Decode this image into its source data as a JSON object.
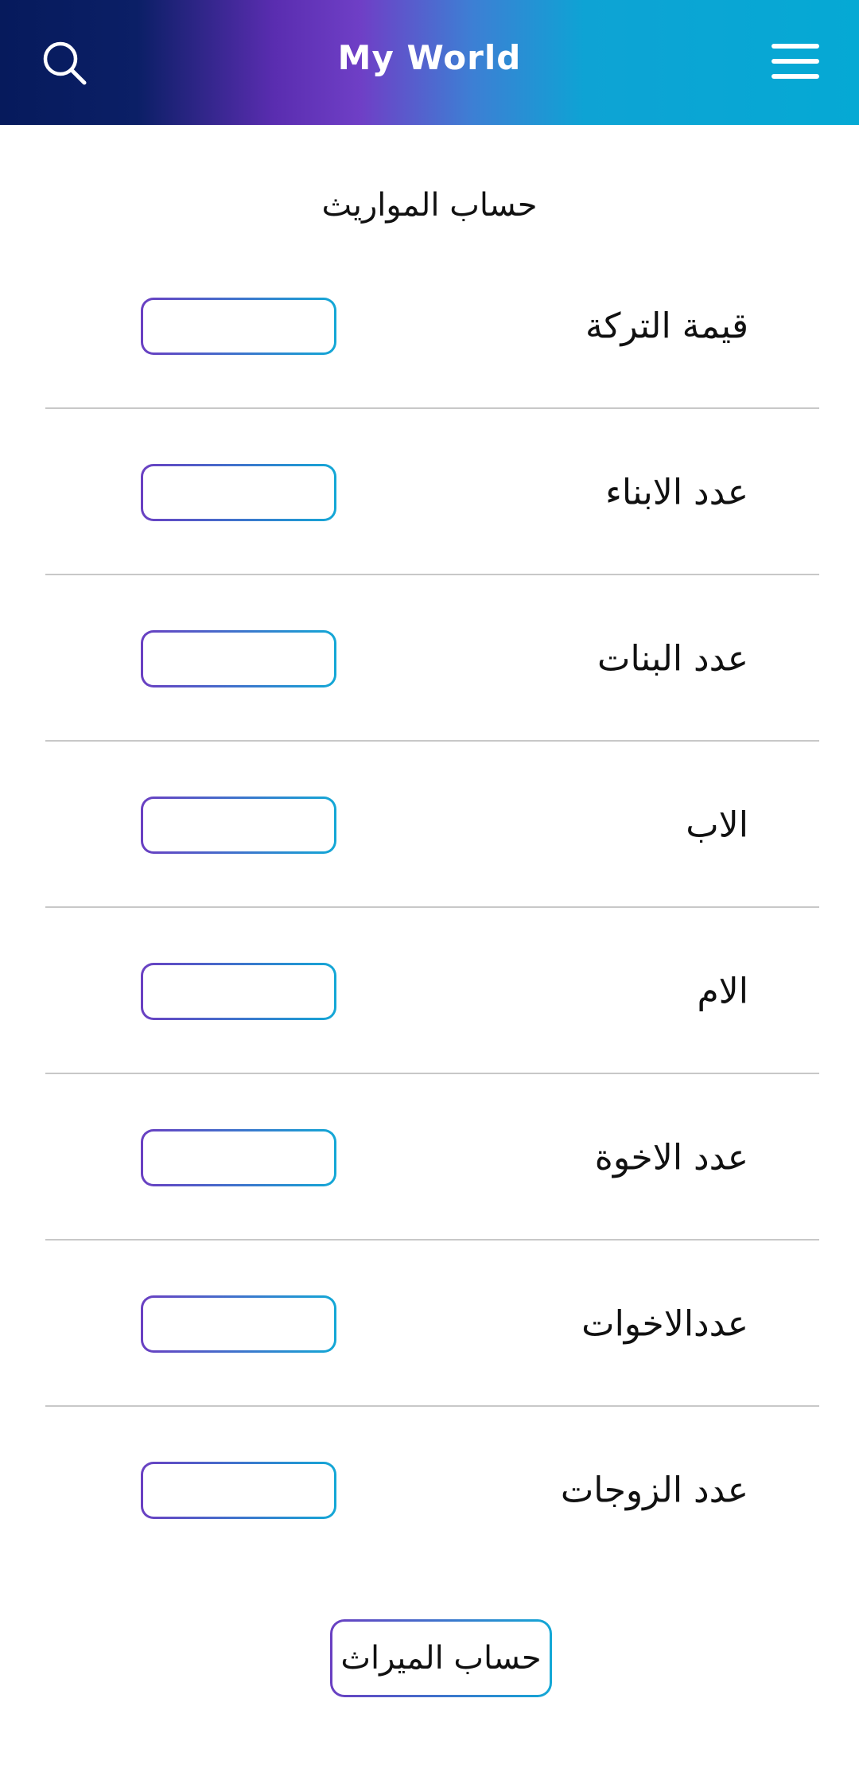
{
  "header": {
    "title": "My World",
    "search_icon": "search-icon",
    "menu_icon": "hamburger-menu-icon",
    "gradient_colors": [
      "#061a5c",
      "#6f3fc6",
      "#05a9d4"
    ]
  },
  "page": {
    "title": "حساب المواريث"
  },
  "form": {
    "fields": [
      {
        "label": "قيمة التركة",
        "value": ""
      },
      {
        "label": "عدد الابناء",
        "value": ""
      },
      {
        "label": "عدد البنات",
        "value": ""
      },
      {
        "label": "الاب",
        "value": ""
      },
      {
        "label": "الام",
        "value": ""
      },
      {
        "label": "عدد الاخوة",
        "value": ""
      },
      {
        "label": "عددالاخوات",
        "value": ""
      },
      {
        "label": "عدد الزوجات",
        "value": ""
      }
    ],
    "field_border_colors": [
      "#6a3fc2",
      "#13a8d6"
    ]
  },
  "actions": {
    "calculate_label": "حساب الميراث"
  }
}
